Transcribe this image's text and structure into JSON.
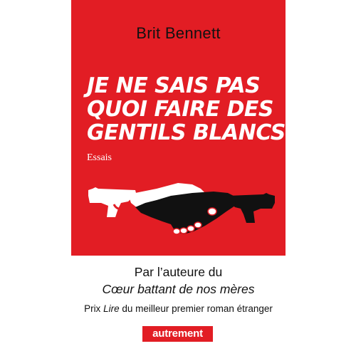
{
  "cover": {
    "author": "Brit Bennett",
    "title_lines": [
      "JE NE SAIS PAS",
      "QUOI FAIRE DES",
      "GENTILS BLANCS"
    ],
    "genre": "Essais",
    "tagline_line1": "Par l’auteure du",
    "tagline_line2": "Cœur battant de nos mères",
    "prize_prefix": "Prix ",
    "prize_italic": "Lire",
    "prize_suffix": " du meilleur premier roman étranger",
    "publisher": "autrement"
  },
  "colors": {
    "red": "#e21d24",
    "black": "#111111",
    "white": "#ffffff"
  },
  "icons": {
    "illustration": "handshake-guns-icon"
  }
}
